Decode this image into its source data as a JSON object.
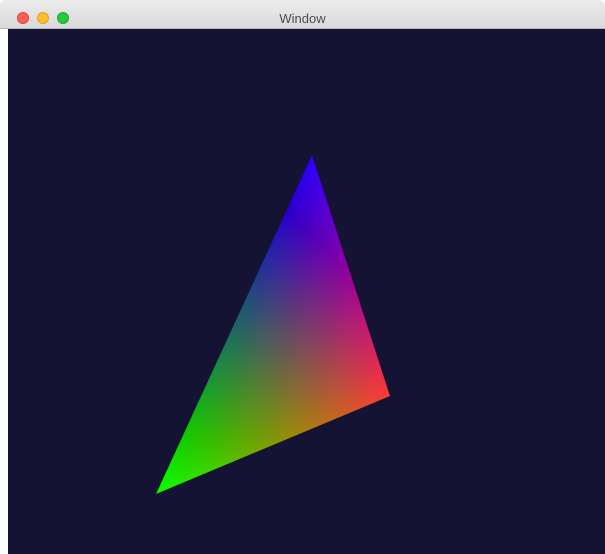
{
  "window": {
    "title": "Window",
    "traffic_lights": {
      "close": {
        "color": "#ff5f57",
        "border": "#e0443e",
        "icon": "close-dot"
      },
      "minimize": {
        "color": "#febc2e",
        "border": "#dea123",
        "icon": "minimize-dot"
      },
      "zoom": {
        "color": "#28c840",
        "border": "#1aab29",
        "icon": "zoom-dot"
      }
    }
  },
  "canvas": {
    "background_color": "#151334",
    "triangle": {
      "vertex_colors": {
        "top": "#0000ff",
        "right": "#ff0000",
        "left": "#00ff00"
      }
    }
  }
}
